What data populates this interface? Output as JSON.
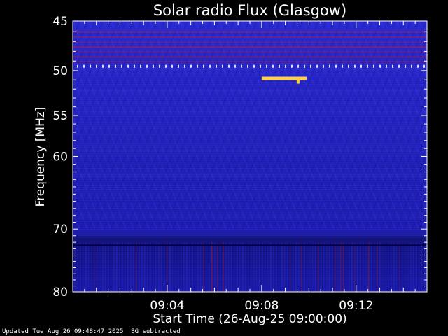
{
  "chart_data": {
    "type": "heatmap",
    "title": "Solar radio Flux (Glasgow)",
    "xlabel": "Start Time (26-Aug-25 09:00:00)",
    "ylabel": "Frequency [MHz]",
    "x_ticks": [
      "09:04",
      "09:08",
      "09:12"
    ],
    "y_ticks": [
      45,
      50,
      55,
      60,
      70,
      80
    ],
    "ylim": [
      80,
      45
    ],
    "y_scale": "log",
    "x_range_minutes": [
      0,
      15
    ],
    "colors": {
      "background": "#000000",
      "low": "#1a1aa0",
      "mid": "#3a3aff",
      "high": "#c0202a",
      "burst": "#ffd040"
    },
    "features": [
      {
        "name": "persistent RFI",
        "freq_range": [
          46,
          49
        ]
      },
      {
        "name": "burst",
        "freq": 50.8,
        "time_range_minutes": [
          8.0,
          9.9
        ]
      }
    ]
  },
  "footer": {
    "updated": "Updated Tue Aug 26 09:48:47 2025",
    "note": "BG subtracted"
  }
}
